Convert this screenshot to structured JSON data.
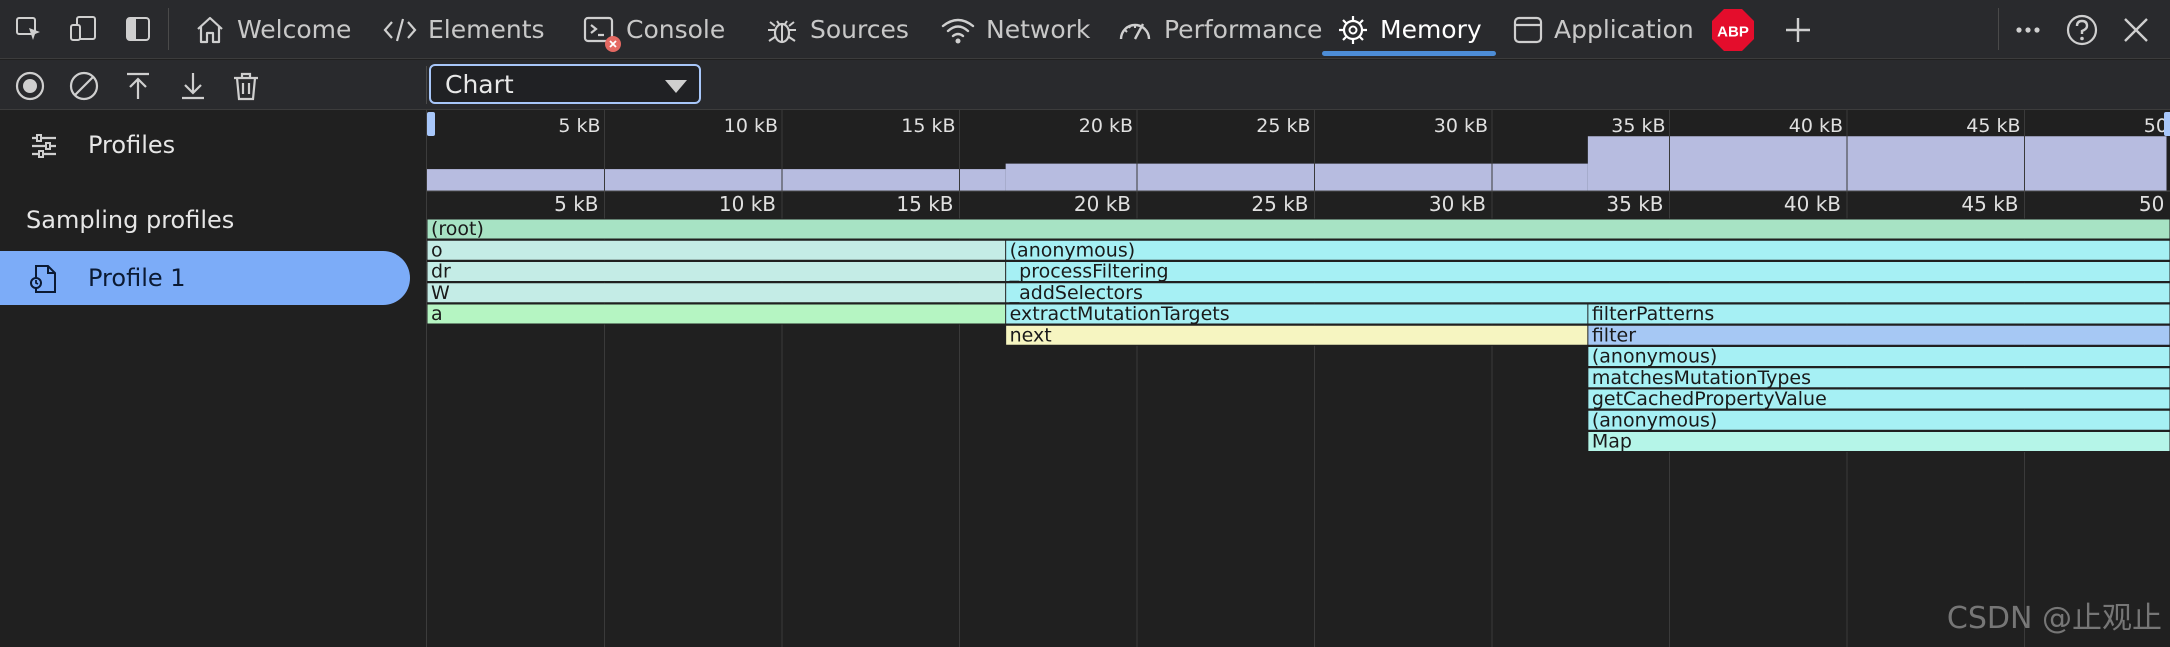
{
  "tabs": [
    {
      "label": "Welcome",
      "icon": "home-icon",
      "active": false
    },
    {
      "label": "Elements",
      "icon": "code-icon",
      "active": false
    },
    {
      "label": "Console",
      "icon": "console-icon",
      "active": false
    },
    {
      "label": "Sources",
      "icon": "bug-icon",
      "active": false
    },
    {
      "label": "Network",
      "icon": "wifi-icon",
      "active": false
    },
    {
      "label": "Performance",
      "icon": "gauge-icon",
      "active": false
    },
    {
      "label": "Memory",
      "icon": "memory-chip-icon",
      "active": true
    },
    {
      "label": "Application",
      "icon": "application-window-icon",
      "active": false
    }
  ],
  "abp_badge": "ABP",
  "view_select": {
    "value": "Chart"
  },
  "sidebar": {
    "profiles_label": "Profiles",
    "section_heading": "Sampling profiles",
    "selected_profile": "Profile 1"
  },
  "colors": {
    "accent": "#4d8dd6",
    "selection": "#7cacf8",
    "overview_fill": "#b7bce0",
    "root": "#a7e3c4",
    "light_mint": "#c4ece6",
    "cyan": "#a6f0f4",
    "green": "#b5f5c2",
    "yellow": "#f6f5c1",
    "blue": "#a6c8f4",
    "mint": "#b5f5e8"
  },
  "chart_data": {
    "type": "flame",
    "unit": "kB",
    "xlim": [
      0,
      49
    ],
    "ticks": [
      5,
      10,
      15,
      20,
      25,
      30,
      35,
      40,
      45,
      50
    ],
    "tick_labels": [
      "5 kB",
      "10 kB",
      "15 kB",
      "20 kB",
      "25 kB",
      "30 kB",
      "35 kB",
      "40 kB",
      "45 kB",
      "50 kB"
    ],
    "overview_steps": [
      {
        "x0": 0,
        "x1": 16.3,
        "value": 12
      },
      {
        "x0": 16.3,
        "x1": 32.7,
        "value": 15
      },
      {
        "x0": 32.7,
        "x1": 49,
        "value": 30
      }
    ],
    "overview_max": 40,
    "frames": [
      {
        "name": "(root)",
        "depth": 0,
        "start": 0,
        "end": 49,
        "color": "root"
      },
      {
        "name": "o",
        "depth": 1,
        "start": 0,
        "end": 16.3,
        "color": "light_mint"
      },
      {
        "name": "(anonymous)",
        "depth": 1,
        "start": 16.3,
        "end": 49,
        "color": "cyan"
      },
      {
        "name": "dr",
        "depth": 2,
        "start": 0,
        "end": 16.3,
        "color": "light_mint"
      },
      {
        "name": "_processFiltering",
        "depth": 2,
        "start": 16.3,
        "end": 49,
        "color": "cyan"
      },
      {
        "name": "W",
        "depth": 3,
        "start": 0,
        "end": 16.3,
        "color": "light_mint"
      },
      {
        "name": "_addSelectors",
        "depth": 3,
        "start": 16.3,
        "end": 49,
        "color": "cyan"
      },
      {
        "name": "a",
        "depth": 4,
        "start": 0,
        "end": 16.3,
        "color": "green"
      },
      {
        "name": "extractMutationTargets",
        "depth": 4,
        "start": 16.3,
        "end": 32.7,
        "color": "cyan"
      },
      {
        "name": "filterPatterns",
        "depth": 4,
        "start": 32.7,
        "end": 49,
        "color": "cyan"
      },
      {
        "name": "next",
        "depth": 5,
        "start": 16.3,
        "end": 32.7,
        "color": "yellow"
      },
      {
        "name": "filter",
        "depth": 5,
        "start": 32.7,
        "end": 49,
        "color": "blue"
      },
      {
        "name": "(anonymous)",
        "depth": 6,
        "start": 32.7,
        "end": 49,
        "color": "cyan"
      },
      {
        "name": "matchesMutationTypes",
        "depth": 7,
        "start": 32.7,
        "end": 49,
        "color": "cyan"
      },
      {
        "name": "getCachedPropertyValue",
        "depth": 8,
        "start": 32.7,
        "end": 49,
        "color": "cyan"
      },
      {
        "name": "(anonymous)",
        "depth": 9,
        "start": 32.7,
        "end": 49,
        "color": "cyan"
      },
      {
        "name": "Map",
        "depth": 10,
        "start": 32.7,
        "end": 49,
        "color": "mint"
      }
    ]
  },
  "watermark": "CSDN @止观止"
}
